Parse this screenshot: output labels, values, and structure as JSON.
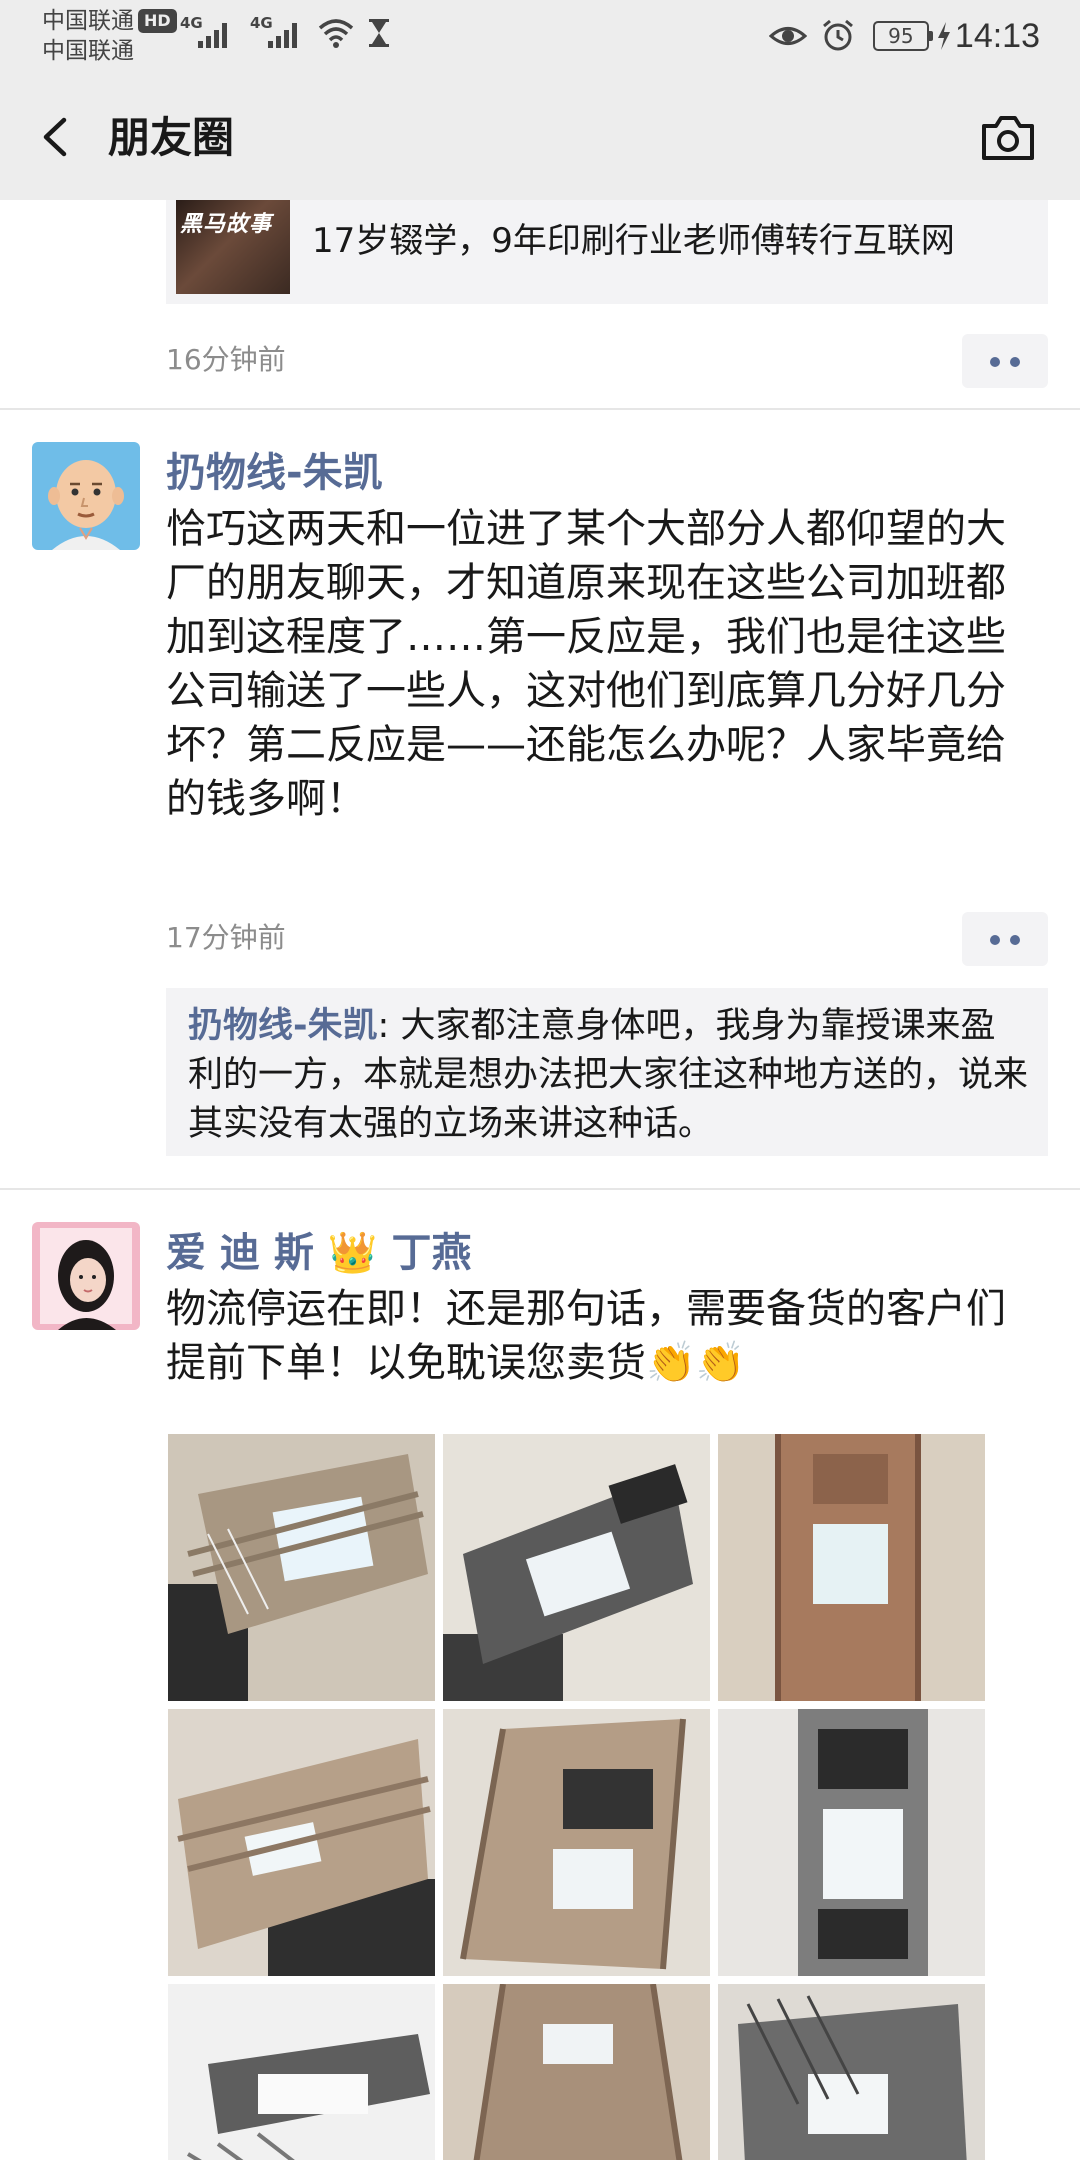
{
  "status_bar": {
    "carrier_1": "中国联通",
    "hd_badge": "HD",
    "carrier_2": "中国联通",
    "signal_1_label": "4G",
    "signal_2_label": "4G",
    "battery": "95",
    "time": "14:13"
  },
  "header": {
    "title": "朋友圈"
  },
  "posts": [
    {
      "link_thumb_text": "黑马故事",
      "link_title": "17岁辍学，9年印刷行业老师傅转行互联网",
      "time": "16分钟前"
    },
    {
      "author": "扔物线-朱凯",
      "text": "恰巧这两天和一位进了某个大部分人都仰望的大厂的朋友聊天，才知道原来现在这些公司加班都加到这程度了……第一反应是，我们也是往这些公司输送了一些人，这对他们到底算几分好几分坏？第二反应是——还能怎么办呢？人家毕竟给的钱多啊！",
      "time": "17分钟前",
      "comment": {
        "name": "扔物线-朱凯",
        "separator": ": ",
        "text": "大家都注意身体吧，我身为靠授课来盈利的一方，本就是想办法把大家往这种地方送的，说来其实没有太强的立场来讲这种话。"
      }
    },
    {
      "author_part1": "爱 迪 斯",
      "author_crown": "👑",
      "author_part2": "丁燕",
      "text": "物流停运在即！还是那句话，需要备货的客户们提前下单！以免耽误您卖货👏👏"
    }
  ],
  "icons": {
    "back": "back-arrow-icon",
    "camera": "camera-icon",
    "more": "more-dots-icon"
  },
  "colors": {
    "link_blue": "#576b95",
    "header_bg": "#ededed",
    "secondary_text": "#8c8c8c"
  }
}
